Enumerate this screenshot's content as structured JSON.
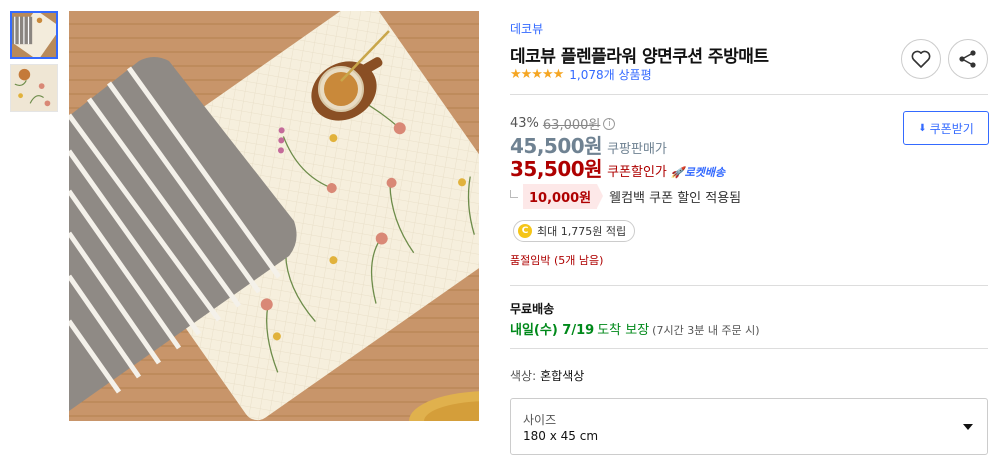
{
  "brand": "데코뷰",
  "title": "데코뷰 플렌플라워 양면쿠션 주방매트",
  "rating": {
    "stars": 5,
    "review_count": "1,078개 상품평"
  },
  "icons": {
    "heart": "heart-icon",
    "share": "share-icon",
    "download": "download-icon",
    "rocket": "rocket-icon",
    "coin": "coin-icon",
    "info": "info-icon",
    "caret": "caret-down-icon"
  },
  "pricing": {
    "discount_rate": "43%",
    "original_price": "63,000원",
    "info_symbol": "i",
    "sale_price": "45,500원",
    "sale_label": "쿠팡판매가",
    "coupon_price": "35,500원",
    "coupon_label": "쿠폰할인가",
    "rocket_label": "로켓배송",
    "coupon_button_label": "쿠폰받기",
    "coupon_button_icon": "⬇"
  },
  "cashback": {
    "amount": "10,000원",
    "text": "웰컴백 쿠폰 할인 적용됨"
  },
  "points": {
    "coin_symbol": "C",
    "text": "최대 1,775원 적립"
  },
  "stock_warning": "품절임박 (5개 남음)",
  "shipping": {
    "title": "무료배송",
    "date": "내일(수) 7/19",
    "arrival": "도착 보장",
    "cutoff": "(7시간 3분 내 주문 시)"
  },
  "color_option": {
    "label": "색상:",
    "value": "혼합색상"
  },
  "size_option": {
    "label": "사이즈",
    "value": "180 x 45 cm"
  },
  "colors": {
    "accent": "#346aff",
    "sale_gray": "#6f8292",
    "coupon_red": "#ae0000",
    "ship_green": "#00891a",
    "star": "#f5a623"
  }
}
